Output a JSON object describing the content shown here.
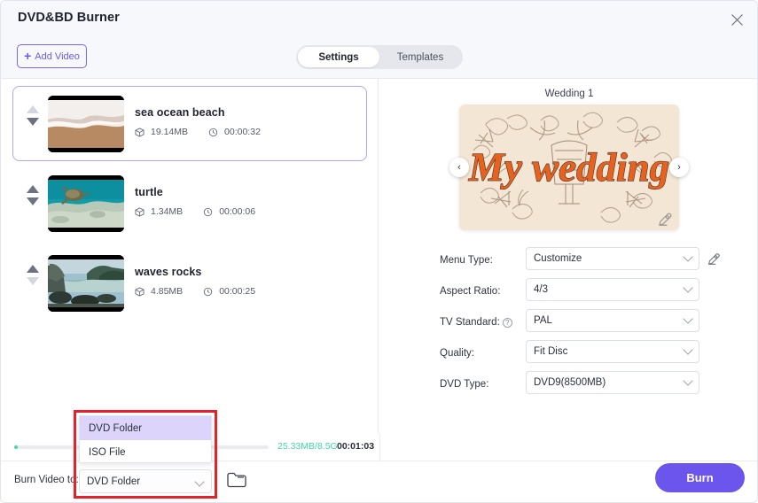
{
  "window": {
    "title": "DVD&BD Burner",
    "close_icon": "close-icon"
  },
  "toolbar": {
    "add_video_label": "Add Video",
    "add_icon": "plus-icon",
    "tabs": [
      {
        "label": "Settings",
        "active": true
      },
      {
        "label": "Templates",
        "active": false
      }
    ]
  },
  "video_list": [
    {
      "title": "sea ocean beach",
      "size": "19.14MB",
      "duration": "00:00:32",
      "selected": true,
      "move_up_enabled": false,
      "move_down_enabled": true,
      "thumb": "sea-ocean-beach-thumbnail"
    },
    {
      "title": "turtle",
      "size": "1.34MB",
      "duration": "00:00:06",
      "selected": false,
      "move_up_enabled": true,
      "move_down_enabled": true,
      "thumb": "turtle-thumbnail"
    },
    {
      "title": "waves rocks",
      "size": "4.85MB",
      "duration": "00:00:25",
      "selected": false,
      "move_up_enabled": true,
      "move_down_enabled": false,
      "thumb": "waves-rocks-thumbnail"
    }
  ],
  "preview": {
    "template_name": "Wedding 1",
    "poster_text": "My wedding",
    "prev_icon": "chevron-left-icon",
    "next_icon": "chevron-right-icon",
    "edit_icon": "pencil-icon"
  },
  "settings": [
    {
      "label": "Menu Type:",
      "value": "Customize",
      "has_pencil": true,
      "has_help": false
    },
    {
      "label": "Aspect Ratio:",
      "value": "4/3",
      "has_pencil": false,
      "has_help": false
    },
    {
      "label": "TV Standard:",
      "value": "PAL",
      "has_pencil": false,
      "has_help": true
    },
    {
      "label": "Quality:",
      "value": "Fit Disc",
      "has_pencil": false,
      "has_help": false
    },
    {
      "label": "DVD Type:",
      "value": "DVD9(8500MB)",
      "has_pencil": false,
      "has_help": false
    }
  ],
  "status": {
    "size_used": "25.33MB/8.5G",
    "total_time": "00:01:03",
    "progress_percent": 1
  },
  "footer": {
    "burn_to_label": "Burn Video to:",
    "burn_to_value": "DVD Folder",
    "folder_icon": "folder-icon",
    "burn_button_label": "Burn",
    "dropdown_options": [
      {
        "label": "DVD Folder",
        "highlighted": true
      },
      {
        "label": "ISO File",
        "highlighted": false
      }
    ]
  },
  "colors": {
    "accent": "#6c55ec",
    "accent_light": "#ddd4fb",
    "progress_green": "#3fd9a7",
    "highlight_red": "#e8202a",
    "poster_orange": "#e8621f"
  }
}
